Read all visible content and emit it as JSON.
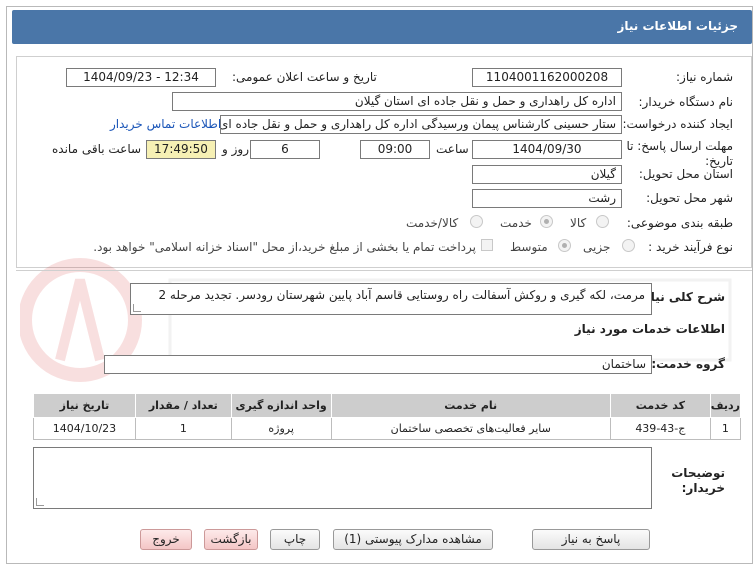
{
  "header": {
    "title": "جزئیات اطلاعات نیاز"
  },
  "form": {
    "need_number_label": "شماره نیاز:",
    "need_number": "1104001162000208",
    "announce_label": "تاریخ و ساعت اعلان عمومی:",
    "announce_value": "1404/09/23 - 12:34",
    "buyer_org_label": "نام دستگاه خریدار:",
    "buyer_org": "اداره کل راهداری و حمل و نقل جاده ای استان گیلان",
    "requester_label": "ایجاد کننده درخواست:",
    "requester": "ستار حسینی کارشناس پیمان ورسیدگی اداره کل راهداری و حمل و نقل جاده ای",
    "contact_link": "اطلاعات تماس خریدار",
    "deadline_label": "مهلت ارسال پاسخ: تا تاریخ:",
    "deadline_date": "1404/09/30",
    "time_label": "ساعت",
    "deadline_time": "09:00",
    "days_value": "6",
    "days_label": "روز و",
    "remaining_time": "17:49:50",
    "remaining_label": "ساعت باقی مانده",
    "province_label": "استان محل تحویل:",
    "province": "گیلان",
    "city_label": "شهر محل تحویل:",
    "city": "رشت",
    "category_label": "طبقه بندی موضوعی:",
    "category_options": [
      "کالا",
      "خدمت",
      "کالا/خدمت"
    ],
    "category_selected": "خدمت",
    "process_label": "نوع فرآیند خرید :",
    "process_options": [
      "جزیی",
      "متوسط"
    ],
    "process_selected": "متوسط",
    "payment_note": "پرداخت تمام یا بخشی از مبلغ خرید،از محل \"اسناد خزانه اسلامی\" خواهد بود."
  },
  "description": {
    "label": "شرح کلی نیاز:",
    "value": "مرمت، لکه گیری و روکش آسفالت راه روستایی قاسم آباد پایین شهرستان رودسر. تجدید مرحله 2"
  },
  "services": {
    "section_title": "اطلاعات خدمات مورد نیاز",
    "group_label": "گروه خدمت:",
    "group_value": "ساختمان",
    "table": {
      "headers": [
        "ردیف",
        "کد خدمت",
        "نام خدمت",
        "واحد اندازه گیری",
        "تعداد / مقدار",
        "تاریخ نیاز"
      ],
      "rows": [
        [
          "1",
          "ج-43-439",
          "سایر فعالیت‌های تخصصی ساختمان",
          "پروژه",
          "1",
          "1404/10/23"
        ]
      ]
    }
  },
  "buyer_notes": {
    "label": "توضیحات خریدار:",
    "value": ""
  },
  "buttons": {
    "reply": "پاسخ به نیاز",
    "attachments": "مشاهده مدارک پیوستی (1)",
    "print": "چاپ",
    "back": "بازگشت",
    "exit": "خروج"
  },
  "colors": {
    "header_bg": "#4a76a8",
    "link": "#1a55b8",
    "remaining_bg": "#f6f0b4"
  }
}
